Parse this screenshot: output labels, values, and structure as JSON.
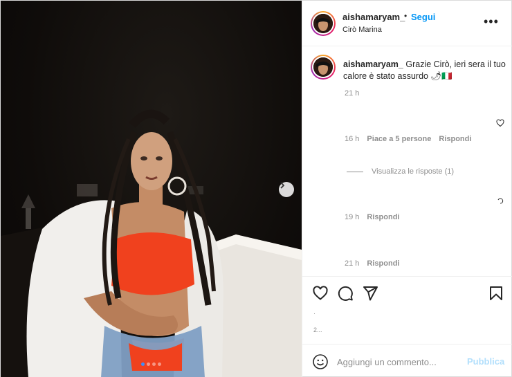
{
  "post": {
    "username": "aishamaryam_",
    "follow_label": "Segui",
    "separator": "•",
    "location": "Cirò Marina",
    "more_icon": "more-horizontal-icon",
    "carousel_total": 4,
    "carousel_active": 1
  },
  "caption": {
    "username": "aishamaryam_",
    "text": "Grazie Cirò, ieri sera il tuo calore è stato assurdo 🌶🇮🇹",
    "time": "21 h"
  },
  "comments": [
    {
      "time": "16 h",
      "likes": "Piace a 5 persone",
      "reply_label": "Rispondi"
    },
    {
      "time": "19 h",
      "reply_label": "Rispondi"
    },
    {
      "time": "21 h",
      "reply_label": "Rispondi"
    }
  ],
  "view_replies": "Visualizza le risposte (1)",
  "actions": {
    "like_icon": "heart-icon",
    "comment_icon": "comment-icon",
    "share_icon": "send-icon",
    "save_icon": "bookmark-icon"
  },
  "likes_text": "·",
  "post_time": "2...",
  "add_comment": {
    "placeholder": "Aggiungi un commento...",
    "publish_label": "Pubblica",
    "emoji_icon": "emoji-icon"
  },
  "colors": {
    "accent": "#0095f6",
    "publish_disabled": "#b2dffc",
    "muted": "#8e8e8e",
    "text": "#262626"
  }
}
